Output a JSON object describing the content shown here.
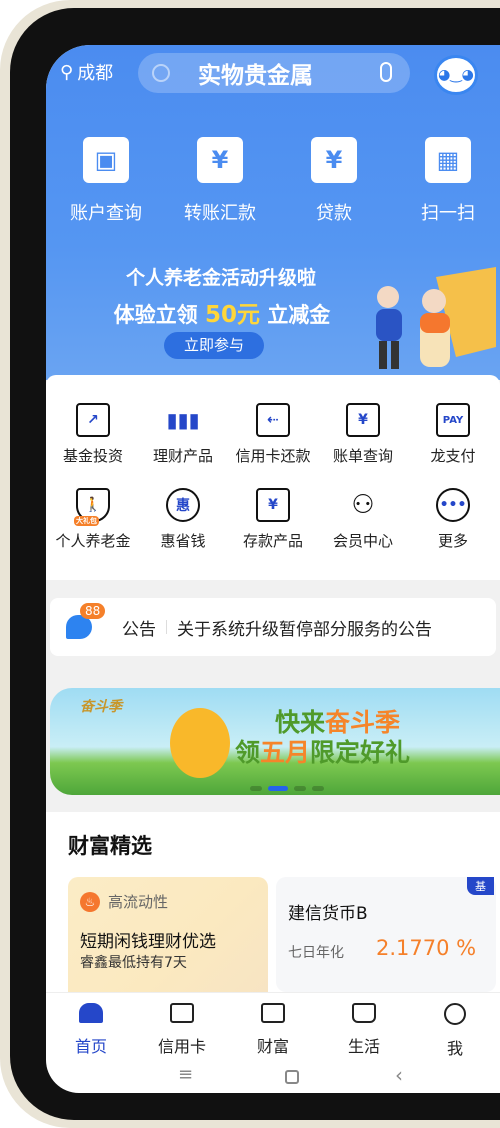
{
  "header": {
    "location": "成都",
    "search_text": "实物贵金属"
  },
  "quick_actions": [
    {
      "label": "账户查询",
      "icon": "wallet-icon"
    },
    {
      "label": "转账汇款",
      "icon": "transfer-icon"
    },
    {
      "label": "贷款",
      "icon": "money-bag-icon"
    },
    {
      "label": "扫一扫",
      "icon": "scan-icon"
    }
  ],
  "promo": {
    "line1": "个人养老金活动升级啦",
    "line2_prefix": "体验立领",
    "amount": "50元",
    "line2_suffix": "立减金",
    "button": "立即参与"
  },
  "services": [
    {
      "label": "基金投资",
      "icon": "chart-trend-icon"
    },
    {
      "label": "理财产品",
      "icon": "bar-chart-icon"
    },
    {
      "label": "信用卡还款",
      "icon": "card-repay-icon"
    },
    {
      "label": "账单查询",
      "icon": "bill-icon"
    },
    {
      "label": "龙支付",
      "icon": "pay-icon",
      "glyph": "PAY"
    },
    {
      "label": "个人养老金",
      "icon": "pension-shield-icon",
      "badge": "大礼包"
    },
    {
      "label": "惠省钱",
      "icon": "discount-bag-icon",
      "glyph": "惠"
    },
    {
      "label": "存款产品",
      "icon": "deposit-icon",
      "glyph": "¥"
    },
    {
      "label": "会员中心",
      "icon": "member-icon"
    },
    {
      "label": "更多",
      "icon": "more-icon",
      "glyph": "•••"
    }
  ],
  "notice": {
    "badge": "88",
    "label": "公告",
    "text": "关于系统升级暂停部分服务的公告"
  },
  "banner": {
    "logo": "奋斗季",
    "line1_a": "快来",
    "line1_b": "奋斗季",
    "line2_a": "领",
    "line2_b": "五月",
    "line2_c": "限定好礼",
    "active_slide": 2,
    "slides": 4
  },
  "wealth": {
    "title": "财富精选",
    "card1": {
      "tag": "高流动性",
      "title": "短期闲钱理财优选",
      "subtitle": "睿鑫最低持有7天"
    },
    "card2": {
      "name": "建信货币B",
      "rate_label": "七日年化",
      "rate": "2.1770 %",
      "corner": "基"
    }
  },
  "bottom_nav": [
    {
      "label": "首页",
      "active": true
    },
    {
      "label": "信用卡"
    },
    {
      "label": "财富"
    },
    {
      "label": "生活"
    },
    {
      "label": "我"
    }
  ],
  "colors": {
    "primary": "#4b8cf0",
    "accent": "#f5802a",
    "nav_active": "#2547c9"
  }
}
